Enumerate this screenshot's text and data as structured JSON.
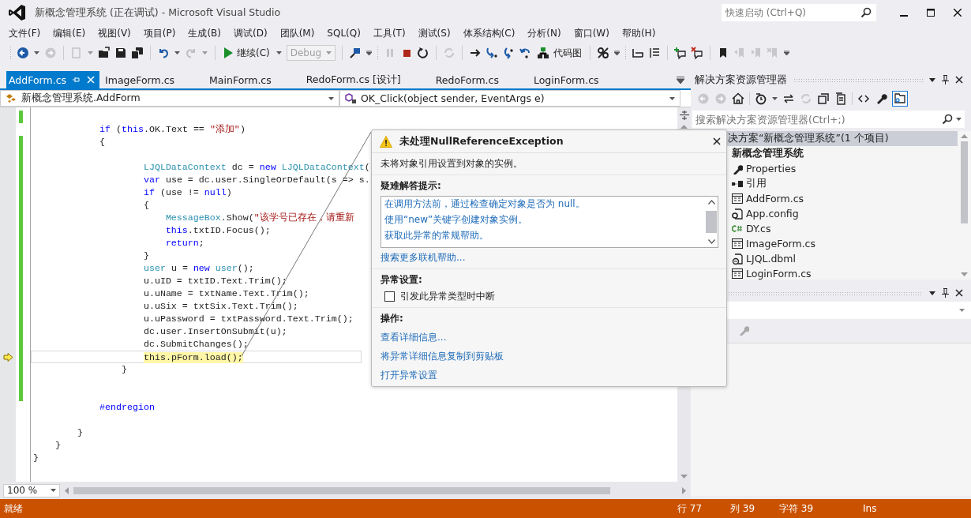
{
  "title_bar": {
    "title": "新概念管理系统 (正在调试) - Microsoft Visual Studio",
    "quick_launch": {
      "placeholder": "快速启动 (Ctrl+Q)"
    }
  },
  "menu": [
    "文件(F)",
    "编辑(E)",
    "视图(V)",
    "项目(P)",
    "生成(B)",
    "调试(D)",
    "团队(M)",
    "SQL(Q)",
    "工具(T)",
    "测试(S)",
    "体系结构(C)",
    "分析(N)",
    "窗口(W)",
    "帮助(H)"
  ],
  "toolbar": {
    "continue": "继续(C)",
    "configuration": {
      "value": "Debug",
      "disabled": true
    },
    "code_map": "代码图"
  },
  "tabs": [
    {
      "label": "AddForm.cs",
      "selected": true
    },
    {
      "label": "ImageForm.cs",
      "selected": false
    },
    {
      "label": "MainForm.cs",
      "selected": false
    },
    {
      "label": "RedoForm.cs [设计]",
      "selected": false
    },
    {
      "label": "RedoForm.cs",
      "selected": false
    },
    {
      "label": "LoginForm.cs",
      "selected": false
    }
  ],
  "navigation": {
    "type": "新概念管理系统.AddForm",
    "member": "OK_Click(object sender, EventArgs e)"
  },
  "code": [
    {
      "changed": true,
      "current": false
    },
    {
      "changed": false,
      "current": false,
      "tokens": [
        {
          "t": "            if",
          "kind": "keyword"
        },
        {
          "t": " ("
        },
        {
          "t": "this",
          "kind": "keyword"
        },
        {
          "t": ".OK.Text == "
        },
        {
          "t": "\"添加\"",
          "kind": "string"
        },
        {
          "t": ")"
        }
      ]
    },
    {
      "changed": true,
      "current": false,
      "tokens": [
        {
          "t": "            {"
        }
      ]
    },
    {
      "changed": true,
      "current": false
    },
    {
      "changed": true,
      "current": false,
      "tokens": [
        {
          "t": "                    LJQLDataContext",
          "kind": "type"
        },
        {
          "t": " dc = "
        },
        {
          "t": "new",
          "kind": "keyword"
        },
        {
          "t": " LJQLDataContext",
          "kind": "type"
        },
        {
          "t": "("
        }
      ]
    },
    {
      "changed": true,
      "current": false,
      "tokens": [
        {
          "t": "                    var",
          "kind": "keyword"
        },
        {
          "t": " use = dc.user.SingleOrDefault(s => s."
        }
      ]
    },
    {
      "changed": true,
      "current": false,
      "tokens": [
        {
          "t": "                    if",
          "kind": "keyword"
        },
        {
          "t": " (use != "
        },
        {
          "t": "null",
          "kind": "keyword"
        },
        {
          "t": ")"
        }
      ]
    },
    {
      "changed": true,
      "current": false,
      "tokens": [
        {
          "t": "                    {"
        }
      ]
    },
    {
      "changed": true,
      "current": false,
      "tokens": [
        {
          "t": "                        MessageBox",
          "kind": "type"
        },
        {
          "t": ".Show("
        },
        {
          "t": "\"该学号已存在，请重新",
          "kind": "string"
        }
      ]
    },
    {
      "changed": true,
      "current": false,
      "tokens": [
        {
          "t": "                        this",
          "kind": "keyword"
        },
        {
          "t": ".txtID.Focus();"
        }
      ]
    },
    {
      "changed": true,
      "current": false,
      "tokens": [
        {
          "t": "                        return",
          "kind": "keyword"
        },
        {
          "t": ";"
        }
      ]
    },
    {
      "changed": true,
      "current": false,
      "tokens": [
        {
          "t": "                    }"
        }
      ]
    },
    {
      "changed": true,
      "current": false,
      "tokens": [
        {
          "t": "                    user",
          "kind": "type"
        },
        {
          "t": " u = "
        },
        {
          "t": "new",
          "kind": "keyword"
        },
        {
          "t": " user",
          "kind": "type"
        },
        {
          "t": "();"
        }
      ]
    },
    {
      "changed": true,
      "current": false,
      "tokens": [
        {
          "t": "                    u.uID = txtID.Text.Trim();"
        }
      ]
    },
    {
      "changed": true,
      "current": false,
      "tokens": [
        {
          "t": "                    u.uName = txtName.Text.Trim();"
        }
      ]
    },
    {
      "changed": true,
      "current": false,
      "tokens": [
        {
          "t": "                    u.uSix = txtSix.Text.Trim();"
        }
      ]
    },
    {
      "changed": true,
      "current": false,
      "tokens": [
        {
          "t": "                    u.uPassword = txtPassword.Text.Trim();"
        }
      ]
    },
    {
      "changed": true,
      "current": false,
      "tokens": [
        {
          "t": "                    dc.user.InsertOnSubmit(u);"
        }
      ]
    },
    {
      "changed": true,
      "current": false,
      "tokens": [
        {
          "t": "                    dc.SubmitChanges();"
        }
      ]
    },
    {
      "changed": true,
      "current": true,
      "tokens": [
        {
          "t": "                    this.pForm.load();",
          "kind": "statement"
        }
      ]
    },
    {
      "changed": true,
      "current": false,
      "tokens": [
        {
          "t": "                }"
        }
      ]
    },
    {
      "changed": true,
      "current": false
    },
    {
      "changed": true,
      "current": false
    },
    {
      "changed": false,
      "current": false,
      "tokens": [
        {
          "t": "            #endregion",
          "kind": "keyword"
        }
      ]
    },
    {
      "changed": false,
      "current": false
    },
    {
      "changed": false,
      "current": false,
      "tokens": [
        {
          "t": "        }"
        }
      ]
    },
    {
      "changed": false,
      "current": false,
      "tokens": [
        {
          "t": "    }"
        }
      ]
    },
    {
      "changed": false,
      "current": false,
      "tokens": [
        {
          "t": "}"
        }
      ]
    }
  ],
  "zoom": "100 %",
  "exception": {
    "title": "未处理NullReferenceException",
    "message": "未将对象引用设置到对象的实例。",
    "tips_heading": "疑难解答提示:",
    "tips": [
      "在调用方法前，通过检查确定对象是否为 null。",
      "使用“new”关键字创建对象实例。",
      "获取此异常的常规帮助。"
    ],
    "search_link": "搜索更多联机帮助...",
    "settings_heading": "异常设置:",
    "break_option": {
      "label": "引发此异常类型时中断",
      "checked": false
    },
    "actions_heading": "操作:",
    "actions": [
      "查看详细信息...",
      "将异常详细信息复制到剪贴板",
      "打开异常设置"
    ]
  },
  "solution_explorer": {
    "title": "解决方案资源管理器",
    "search": {
      "placeholder": "搜索解决方案资源管理器(Ctrl+;)"
    },
    "tree": [
      {
        "label": "决方案“新概念管理系统”(1 个项目)",
        "selected": true,
        "children": [
          {
            "label": "新概念管理系统",
            "selected": false,
            "children": [
              {
                "label": "Properties",
                "kind": "properties",
                "selected": false
              },
              {
                "label": "引用",
                "kind": "references",
                "selected": false
              },
              {
                "label": "AddForm.cs",
                "kind": "form",
                "selected": false
              },
              {
                "label": "App.config",
                "kind": "config",
                "selected": false
              },
              {
                "label": "DY.cs",
                "kind": "csharp",
                "selected": false
              },
              {
                "label": "ImageForm.cs",
                "kind": "form",
                "selected": false
              },
              {
                "label": "LJQL.dbml",
                "kind": "dbml",
                "selected": false
              },
              {
                "label": "LoginForm.cs",
                "kind": "form",
                "selected": false
              }
            ]
          }
        ]
      }
    ]
  },
  "status_bar": {
    "message": "就绪",
    "line": "行 77",
    "column": "列 39",
    "character": "字符 39",
    "mode": "Ins"
  }
}
